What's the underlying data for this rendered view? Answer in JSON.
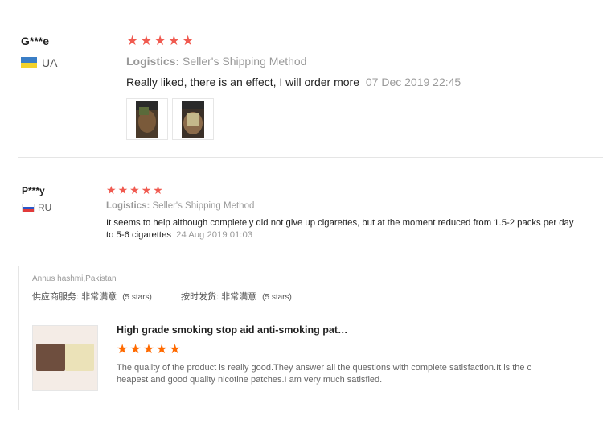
{
  "colors": {
    "star": "#f05a50",
    "star_orange": "#ff6a00",
    "grey_text": "#999999"
  },
  "review1": {
    "user": "G***e",
    "country": "UA",
    "stars": 5,
    "logistics_label": "Logistics:",
    "logistics_value": "Seller's Shipping Method",
    "text": "Really liked, there is an effect, I will order more",
    "date": "07 Dec 2019 22:45"
  },
  "review2": {
    "user": "P***y",
    "country": "RU",
    "stars": 5,
    "logistics_label": "Logistics:",
    "logistics_value": "Seller's Shipping Method",
    "text_line1": "It seems to help although completely did not give up cigarettes, but at the moment reduced from 1.5-2 packs per day",
    "text_line2": "to 5-6 cigarettes",
    "date": "24 Aug 2019 01:03"
  },
  "review3": {
    "user": "Annus hashmi,Pakistan",
    "rating1_label": "供应商服务:",
    "rating1_value": "非常满意",
    "rating1_stars": "(5 stars)",
    "rating2_label": "按时发货:",
    "rating2_value": "非常满意",
    "rating2_stars": "(5 stars)",
    "product_title": "High grade smoking stop aid anti-smoking pat…",
    "stars": 5,
    "text_line1": "The quality of the product is really good.They answer all the questions with complete satisfaction.It is the c",
    "text_line2": "heapest and good quality nicotine patches.I am very much satisfied."
  }
}
